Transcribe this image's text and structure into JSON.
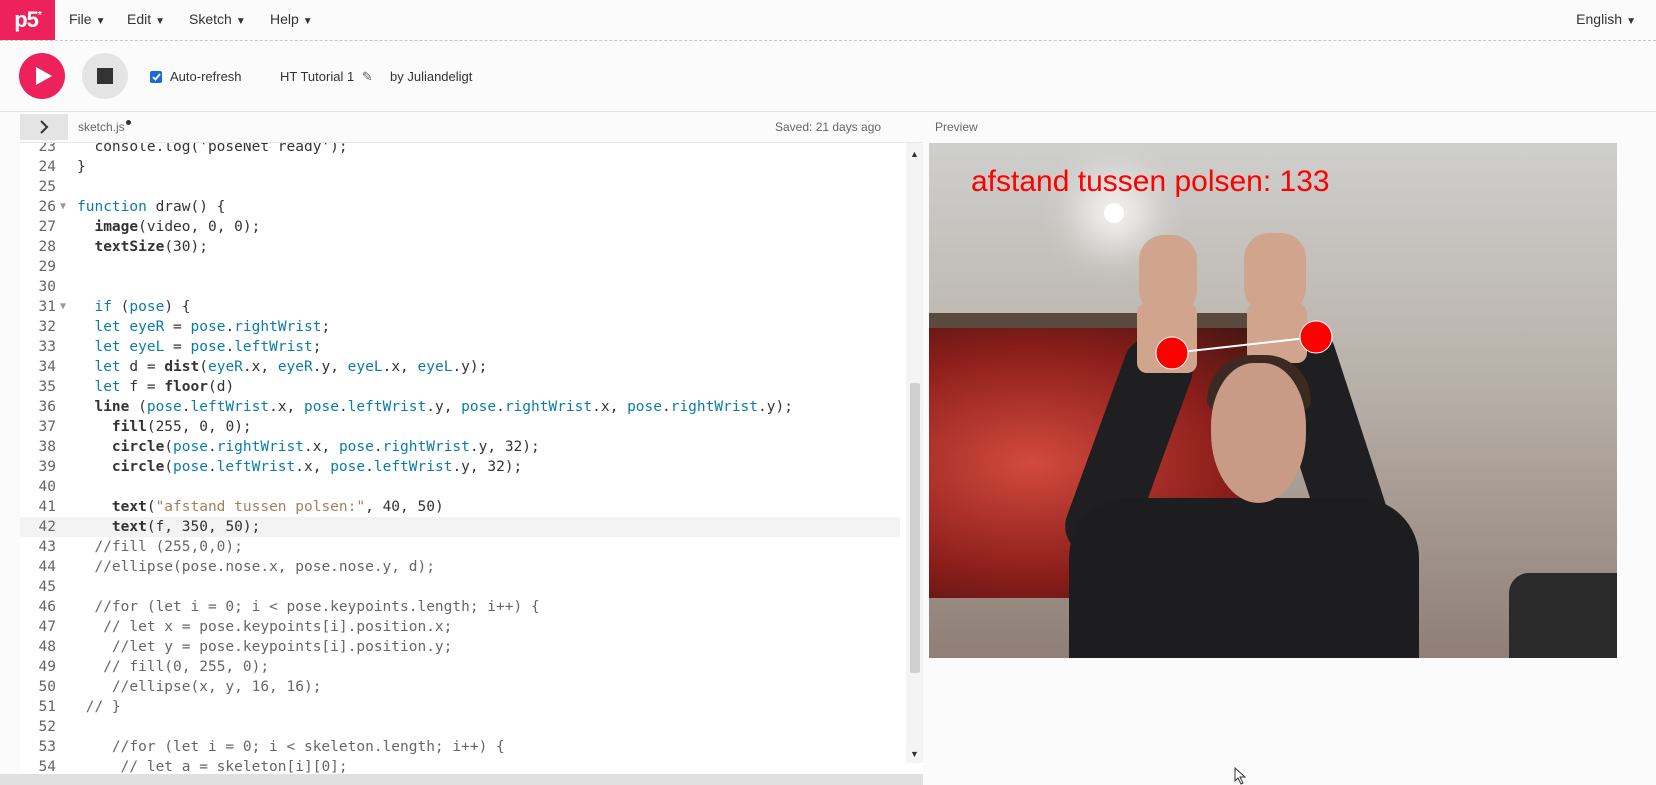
{
  "nav": {
    "logo": "p5",
    "logo_sup": "*",
    "menus": [
      "File",
      "Edit",
      "Sketch",
      "Help"
    ],
    "language": "English"
  },
  "toolbar": {
    "autorefresh_label": "Auto-refresh",
    "autorefresh_checked": true,
    "sketch_name": "HT Tutorial 1",
    "byline": "by Juliandeligt"
  },
  "filebar": {
    "filename": "sketch.js",
    "saved": "Saved: 21 days ago",
    "preview_label": "Preview"
  },
  "editor": {
    "current_line": "42",
    "lines": [
      {
        "n": "23",
        "fold": "",
        "html": "  console.log('poseNet ready');"
      },
      {
        "n": "24",
        "fold": "",
        "html": "}"
      },
      {
        "n": "25",
        "fold": "",
        "html": ""
      },
      {
        "n": "26",
        "fold": "▼",
        "html": "<span class='kw'>function</span> draw() {"
      },
      {
        "n": "27",
        "fold": "",
        "html": "  <span class='fn'>image</span>(video, <span class='num'>0</span>, <span class='num'>0</span>);"
      },
      {
        "n": "28",
        "fold": "",
        "html": "  <span class='fn'>textSize</span>(<span class='num'>30</span>);"
      },
      {
        "n": "29",
        "fold": "",
        "html": ""
      },
      {
        "n": "30",
        "fold": "",
        "html": ""
      },
      {
        "n": "31",
        "fold": "▼",
        "html": "  <span class='kw'>if</span> (<span class='kw'>pose</span>) {"
      },
      {
        "n": "32",
        "fold": "",
        "html": "  <span class='kw'>let</span> <span class='kw'>eyeR</span> = <span class='kw'>pose</span>.<span class='kw'>rightWrist</span>;"
      },
      {
        "n": "33",
        "fold": "",
        "html": "  <span class='kw'>let</span> <span class='kw'>eyeL</span> = <span class='kw'>pose</span>.<span class='kw'>leftWrist</span>;"
      },
      {
        "n": "34",
        "fold": "",
        "html": "  <span class='kw'>let</span> d = <span class='fn'>dist</span>(<span class='kw'>eyeR</span>.x, <span class='kw'>eyeR</span>.y, <span class='kw'>eyeL</span>.x, <span class='kw'>eyeL</span>.y);"
      },
      {
        "n": "35",
        "fold": "",
        "html": "  <span class='kw'>let</span> f = <span class='fn'>floor</span>(d)"
      },
      {
        "n": "36",
        "fold": "",
        "html": "  <span class='fn'>line</span> (<span class='kw'>pose</span>.<span class='kw'>leftWrist</span>.x, <span class='kw'>pose</span>.<span class='kw'>leftWrist</span>.y, <span class='kw'>pose</span>.<span class='kw'>rightWrist</span>.x, <span class='kw'>pose</span>.<span class='kw'>rightWrist</span>.y);"
      },
      {
        "n": "37",
        "fold": "",
        "html": "    <span class='fn'>fill</span>(<span class='num'>255</span>, <span class='num'>0</span>, <span class='num'>0</span>);"
      },
      {
        "n": "38",
        "fold": "",
        "html": "    <span class='fn'>circle</span>(<span class='kw'>pose</span>.<span class='kw'>rightWrist</span>.x, <span class='kw'>pose</span>.<span class='kw'>rightWrist</span>.y, <span class='num'>32</span>);"
      },
      {
        "n": "39",
        "fold": "",
        "html": "    <span class='fn'>circle</span>(<span class='kw'>pose</span>.<span class='kw'>leftWrist</span>.x, <span class='kw'>pose</span>.<span class='kw'>leftWrist</span>.y, <span class='num'>32</span>);"
      },
      {
        "n": "40",
        "fold": "",
        "html": ""
      },
      {
        "n": "41",
        "fold": "",
        "html": "    <span class='fn'>text</span>(<span class='str'>\"afstand tussen polsen:\"</span>, <span class='num'>40</span>, <span class='num'>50</span>)"
      },
      {
        "n": "42",
        "fold": "",
        "html": "    <span class='fn'>text</span>(f, <span class='num'>350</span>, <span class='num'>50</span>);"
      },
      {
        "n": "43",
        "fold": "",
        "html": "  <span class='cm'>//fill (255,0,0);</span>"
      },
      {
        "n": "44",
        "fold": "",
        "html": "  <span class='cm'>//ellipse(pose.nose.x, pose.nose.y, d);</span>"
      },
      {
        "n": "45",
        "fold": "",
        "html": ""
      },
      {
        "n": "46",
        "fold": "",
        "html": "  <span class='cm'>//for (let i = 0; i &lt; pose.keypoints.length; i++) {</span>"
      },
      {
        "n": "47",
        "fold": "",
        "html": "   <span class='cm'>// let x = pose.keypoints[i].position.x;</span>"
      },
      {
        "n": "48",
        "fold": "",
        "html": "    <span class='cm'>//let y = pose.keypoints[i].position.y;</span>"
      },
      {
        "n": "49",
        "fold": "",
        "html": "   <span class='cm'>// fill(0, 255, 0);</span>"
      },
      {
        "n": "50",
        "fold": "",
        "html": "    <span class='cm'>//ellipse(x, y, 16, 16);</span>"
      },
      {
        "n": "51",
        "fold": "",
        "html": " <span class='cm'>// }</span>"
      },
      {
        "n": "52",
        "fold": "",
        "html": ""
      },
      {
        "n": "53",
        "fold": "",
        "html": "    <span class='cm'>//for (let i = 0; i &lt; skeleton.length; i++) {</span>"
      },
      {
        "n": "54",
        "fold": "",
        "html": "     <span class='cm'>// let a = skeleton[i][0];</span>"
      }
    ]
  },
  "preview": {
    "canvas_text": "afstand tussen polsen: 133",
    "circle_color": "#ff0000"
  },
  "colors": {
    "brand": "#ed225d",
    "keyword": "#0b7ca9"
  }
}
